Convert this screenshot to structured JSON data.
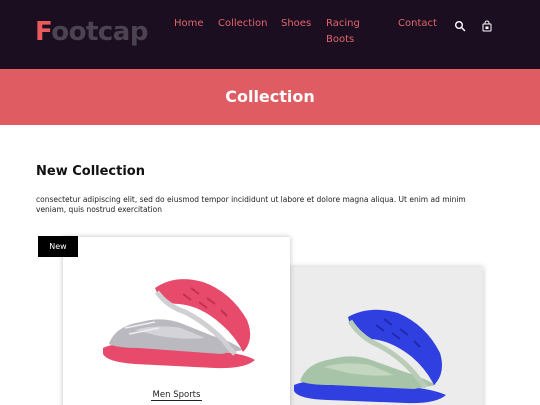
{
  "header": {
    "logo_first": "F",
    "logo_rest": "ootcap",
    "nav": {
      "home": "Home",
      "collection": "Collection",
      "shoes": "Shoes",
      "racing_boots": "Racing Boots",
      "contact": "Contact"
    },
    "icons": [
      "search-icon",
      "shopping-bag-icon"
    ]
  },
  "banner": {
    "title": "Collection"
  },
  "section": {
    "title": "New Collection",
    "description": "consectetur adipiscing elit, sed do eiusmod tempor incididunt ut labore et dolore magna aliqua. Ut enim ad minim veniam, quis nostrud exercitation"
  },
  "products": [
    {
      "badge": "New",
      "label": "Men Sports"
    }
  ],
  "colors": {
    "header_bg": "#1c0e21",
    "accent": "#e2656a",
    "banner_bg": "#de5c62",
    "logo_rest": "#4c4352"
  }
}
